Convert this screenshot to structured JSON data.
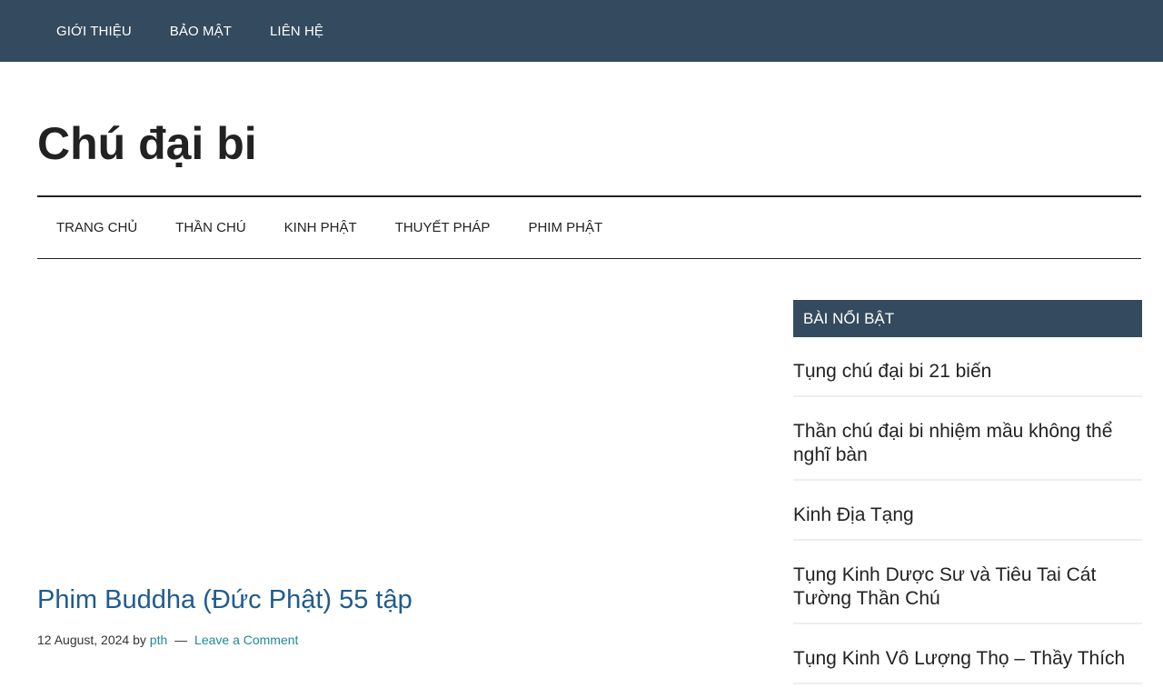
{
  "top_nav": {
    "items": [
      "GIỚI THIỆU",
      "BẢO MẬT",
      "LIÊN HỆ"
    ]
  },
  "site": {
    "title": "Chú đại bi"
  },
  "main_nav": {
    "items": [
      "TRANG CHỦ",
      "THẦN CHÚ",
      "KINH PHẬT",
      "THUYẾT PHÁP",
      "PHIM PHẬT"
    ]
  },
  "post": {
    "title": "Phim Buddha (Đức Phật) 55 tập",
    "date": "12 August, 2024",
    "by": "by",
    "author": "pth",
    "separator": "—",
    "comment_link": "Leave a Comment"
  },
  "sidebar": {
    "widget_title": "BÀI NỔI BẬT",
    "items": [
      "Tụng chú đại bi 21 biến",
      "Thần chú đại bi nhiệm mầu không thể nghĩ bàn",
      "Kinh Địa Tạng",
      "Tụng Kinh Dược Sư và Tiêu Tai Cát Tường Thần Chú",
      "Tụng Kinh Vô Lượng Thọ – Thầy Thích"
    ]
  },
  "colors": {
    "nav_bg": "#344a5e",
    "post_title": "#1f5b8e",
    "link": "#1f8a8f"
  }
}
